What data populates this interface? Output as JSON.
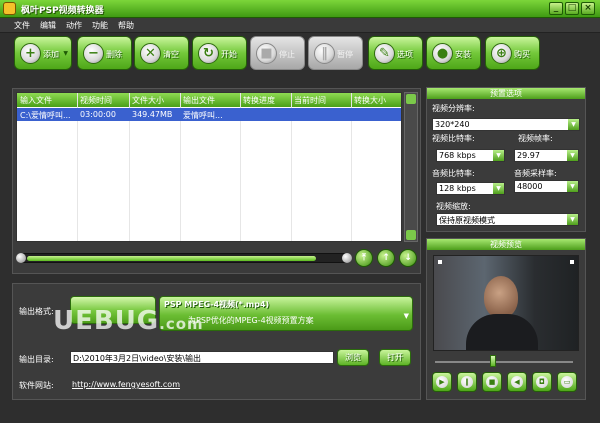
{
  "title": "枫叶PSP视频转换器",
  "window": {
    "minimize": "_",
    "maximize": "□",
    "close": "×"
  },
  "menu": [
    "文件",
    "编辑",
    "动作",
    "功能",
    "帮助"
  ],
  "toolbar": {
    "add": "添加",
    "delete": "删除",
    "clear": "清空",
    "start": "开始",
    "stop": "停止",
    "pause": "暂停",
    "options": "选项",
    "install": "安装",
    "buy": "购买"
  },
  "table": {
    "columns": [
      "输入文件",
      "视频时间",
      "文件大小",
      "输出文件",
      "转换进度",
      "当前时间",
      "转换大小"
    ],
    "rows": [
      {
        "input": "C:\\爱情呼叫...",
        "time": "03:00:00",
        "size": "349.47MB",
        "output": "爱情呼叫...",
        "progress": "",
        "current": "",
        "convsize": ""
      }
    ]
  },
  "progress": {
    "value": 0.92
  },
  "output": {
    "format_label": "输出格式:",
    "format_name": "PSP MPEG-4视频(*.mp4)",
    "format_desc": "为PSP优化的MPEG-4视频预置方案",
    "dir_label": "输出目录:",
    "dir_value": "D:\\2010年3月2日\\video\\安装\\输出",
    "browse": "浏览",
    "open": "打开",
    "site_label": "软件网站:",
    "site_url": "http://www.fengyesoft.com",
    "watermark": "UEBUG",
    "watermark_suffix": ".com"
  },
  "presets": {
    "header": "预置选项",
    "resolution_label": "视频分辨率:",
    "resolution": "320*240",
    "vbitrate_label": "视频比特率:",
    "vbitrate": "768 kbps",
    "fps_label": "视频帧率:",
    "fps": "29.97",
    "abitrate_label": "音频比特率:",
    "abitrate": "128 kbps",
    "samplerate_label": "音频采样率:",
    "samplerate": "48000",
    "scale_label": "视频缩放:",
    "scale": "保持原视频模式"
  },
  "preview": {
    "header": "视频预览",
    "seek": 0.4
  }
}
